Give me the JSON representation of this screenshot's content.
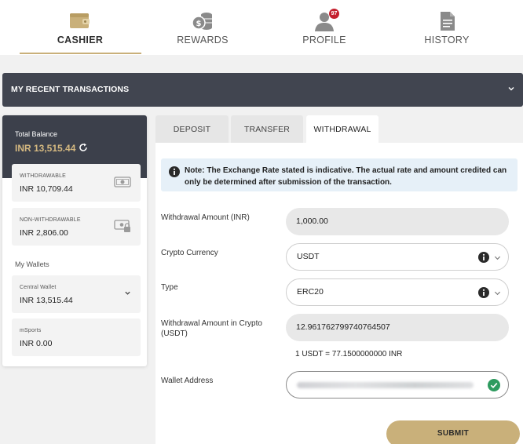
{
  "nav": {
    "items": [
      {
        "label": "CASHIER",
        "icon": "wallet-icon",
        "active": true
      },
      {
        "label": "REWARDS",
        "icon": "coins-icon",
        "active": false
      },
      {
        "label": "PROFILE",
        "icon": "user-icon",
        "active": false
      },
      {
        "label": "HISTORY",
        "icon": "document-icon",
        "active": false
      }
    ],
    "profile_badge": "97"
  },
  "recent_transactions": {
    "title": "MY RECENT TRANSACTIONS",
    "icon": "chevron-down-icon"
  },
  "balance": {
    "total_label": "Total Balance",
    "total_value": "INR 13,515.44",
    "withdrawable_label": "WITHDRAWABLE",
    "withdrawable_value": "INR 10,709.44",
    "non_withdrawable_label": "NON-WITHDRAWABLE",
    "non_withdrawable_value": "INR 2,806.00"
  },
  "wallets": {
    "title": "My Wallets",
    "items": [
      {
        "label": "Central Wallet",
        "value": "INR 13,515.44"
      },
      {
        "label": "mSports",
        "value": "INR 0.00"
      }
    ]
  },
  "tabs": [
    {
      "label": "DEPOSIT",
      "active": false
    },
    {
      "label": "TRANSFER",
      "active": false
    },
    {
      "label": "WITHDRAWAL",
      "active": true
    }
  ],
  "form": {
    "note": "Note: The Exchange Rate stated is indicative. The actual rate and amount credited can only be determined after submission of the transaction.",
    "amount_label": "Withdrawal Amount (INR)",
    "amount_value": "1,000.00",
    "crypto_label": "Crypto Currency",
    "crypto_value": "USDT",
    "type_label": "Type",
    "type_value": "ERC20",
    "crypto_amount_label": "Withdrawal Amount in Crypto (USDT)",
    "crypto_amount_value": "12.961762799740764507",
    "rate_text": "1 USDT = 77.1500000000 INR",
    "address_label": "Wallet Address",
    "submit_label": "SUBMIT"
  },
  "colors": {
    "accent": "#c9b07a",
    "dark_bar": "#414550",
    "balance_gold": "#d4b880",
    "badge": "#c4202e",
    "success": "#2e9b5f",
    "note_bg": "#e6f0f8"
  }
}
